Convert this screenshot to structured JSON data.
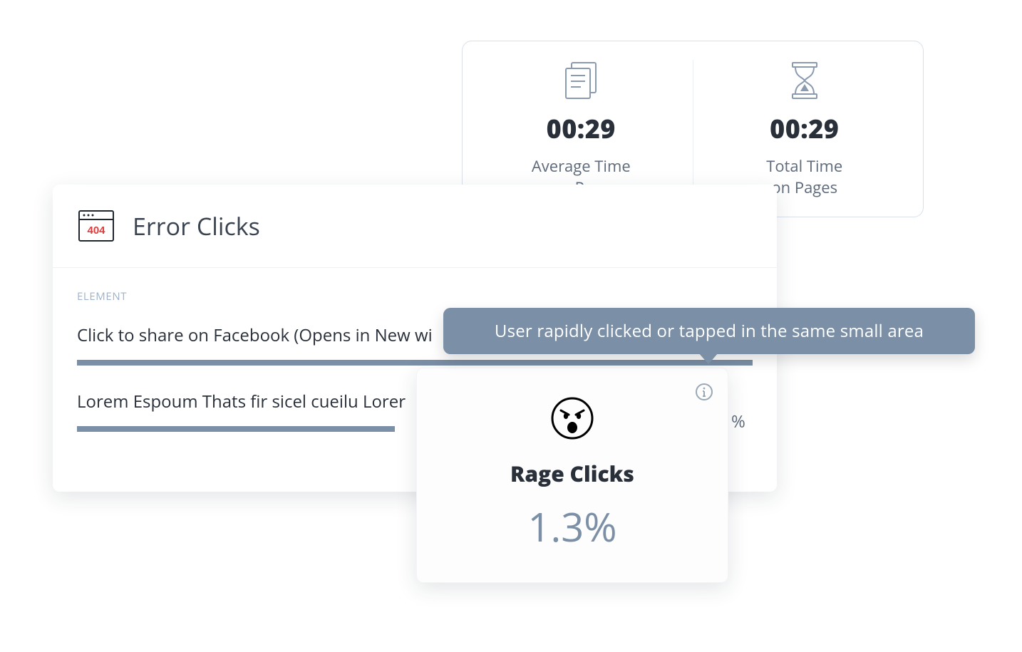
{
  "stats": {
    "avg_time": {
      "value": "00:29",
      "label_line1": "Average Time",
      "label_line2": "on Page"
    },
    "total_time": {
      "value": "00:29",
      "label_line1": "Total Time",
      "label_line2": "on Pages"
    }
  },
  "error_clicks": {
    "title": "Error Clicks",
    "column_label": "ELEMENT",
    "rows": [
      {
        "name": "Click to share on Facebook (Opens in New wi",
        "bar_pct": 100
      },
      {
        "name": "Lorem Espoum Thats fir sicel cueilu Lorer",
        "bar_pct": 47
      }
    ]
  },
  "rage_clicks": {
    "tooltip": "User rapidly clicked or tapped in the same small area",
    "title": "Rage Clicks",
    "value": "1.3%"
  },
  "ghost_percent": "%"
}
